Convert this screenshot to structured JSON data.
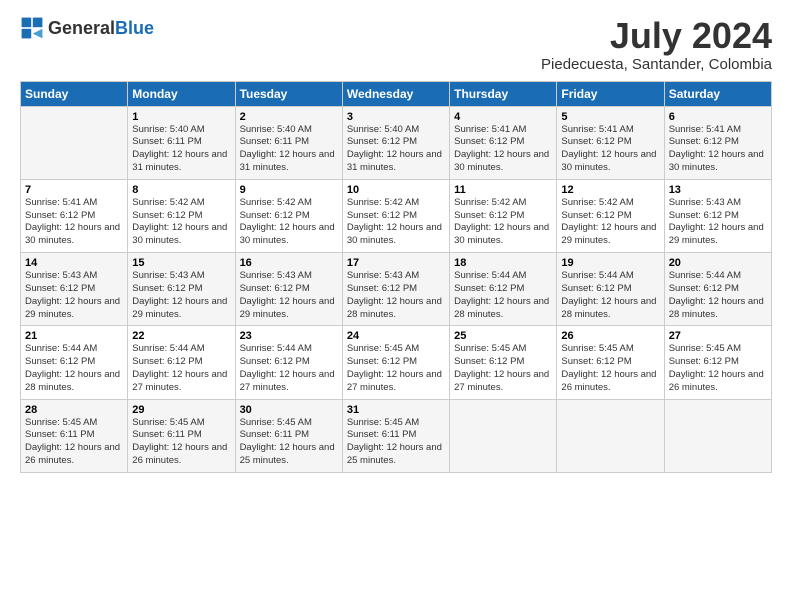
{
  "logo": {
    "general": "General",
    "blue": "Blue"
  },
  "title": "July 2024",
  "subtitle": "Piedecuesta, Santander, Colombia",
  "days_of_week": [
    "Sunday",
    "Monday",
    "Tuesday",
    "Wednesday",
    "Thursday",
    "Friday",
    "Saturday"
  ],
  "weeks": [
    [
      {
        "day": "",
        "sunrise": "",
        "sunset": "",
        "daylight": ""
      },
      {
        "day": "1",
        "sunrise": "Sunrise: 5:40 AM",
        "sunset": "Sunset: 6:11 PM",
        "daylight": "Daylight: 12 hours and 31 minutes."
      },
      {
        "day": "2",
        "sunrise": "Sunrise: 5:40 AM",
        "sunset": "Sunset: 6:11 PM",
        "daylight": "Daylight: 12 hours and 31 minutes."
      },
      {
        "day": "3",
        "sunrise": "Sunrise: 5:40 AM",
        "sunset": "Sunset: 6:12 PM",
        "daylight": "Daylight: 12 hours and 31 minutes."
      },
      {
        "day": "4",
        "sunrise": "Sunrise: 5:41 AM",
        "sunset": "Sunset: 6:12 PM",
        "daylight": "Daylight: 12 hours and 30 minutes."
      },
      {
        "day": "5",
        "sunrise": "Sunrise: 5:41 AM",
        "sunset": "Sunset: 6:12 PM",
        "daylight": "Daylight: 12 hours and 30 minutes."
      },
      {
        "day": "6",
        "sunrise": "Sunrise: 5:41 AM",
        "sunset": "Sunset: 6:12 PM",
        "daylight": "Daylight: 12 hours and 30 minutes."
      }
    ],
    [
      {
        "day": "7",
        "sunrise": "Sunrise: 5:41 AM",
        "sunset": "Sunset: 6:12 PM",
        "daylight": "Daylight: 12 hours and 30 minutes."
      },
      {
        "day": "8",
        "sunrise": "Sunrise: 5:42 AM",
        "sunset": "Sunset: 6:12 PM",
        "daylight": "Daylight: 12 hours and 30 minutes."
      },
      {
        "day": "9",
        "sunrise": "Sunrise: 5:42 AM",
        "sunset": "Sunset: 6:12 PM",
        "daylight": "Daylight: 12 hours and 30 minutes."
      },
      {
        "day": "10",
        "sunrise": "Sunrise: 5:42 AM",
        "sunset": "Sunset: 6:12 PM",
        "daylight": "Daylight: 12 hours and 30 minutes."
      },
      {
        "day": "11",
        "sunrise": "Sunrise: 5:42 AM",
        "sunset": "Sunset: 6:12 PM",
        "daylight": "Daylight: 12 hours and 30 minutes."
      },
      {
        "day": "12",
        "sunrise": "Sunrise: 5:42 AM",
        "sunset": "Sunset: 6:12 PM",
        "daylight": "Daylight: 12 hours and 29 minutes."
      },
      {
        "day": "13",
        "sunrise": "Sunrise: 5:43 AM",
        "sunset": "Sunset: 6:12 PM",
        "daylight": "Daylight: 12 hours and 29 minutes."
      }
    ],
    [
      {
        "day": "14",
        "sunrise": "Sunrise: 5:43 AM",
        "sunset": "Sunset: 6:12 PM",
        "daylight": "Daylight: 12 hours and 29 minutes."
      },
      {
        "day": "15",
        "sunrise": "Sunrise: 5:43 AM",
        "sunset": "Sunset: 6:12 PM",
        "daylight": "Daylight: 12 hours and 29 minutes."
      },
      {
        "day": "16",
        "sunrise": "Sunrise: 5:43 AM",
        "sunset": "Sunset: 6:12 PM",
        "daylight": "Daylight: 12 hours and 29 minutes."
      },
      {
        "day": "17",
        "sunrise": "Sunrise: 5:43 AM",
        "sunset": "Sunset: 6:12 PM",
        "daylight": "Daylight: 12 hours and 28 minutes."
      },
      {
        "day": "18",
        "sunrise": "Sunrise: 5:44 AM",
        "sunset": "Sunset: 6:12 PM",
        "daylight": "Daylight: 12 hours and 28 minutes."
      },
      {
        "day": "19",
        "sunrise": "Sunrise: 5:44 AM",
        "sunset": "Sunset: 6:12 PM",
        "daylight": "Daylight: 12 hours and 28 minutes."
      },
      {
        "day": "20",
        "sunrise": "Sunrise: 5:44 AM",
        "sunset": "Sunset: 6:12 PM",
        "daylight": "Daylight: 12 hours and 28 minutes."
      }
    ],
    [
      {
        "day": "21",
        "sunrise": "Sunrise: 5:44 AM",
        "sunset": "Sunset: 6:12 PM",
        "daylight": "Daylight: 12 hours and 28 minutes."
      },
      {
        "day": "22",
        "sunrise": "Sunrise: 5:44 AM",
        "sunset": "Sunset: 6:12 PM",
        "daylight": "Daylight: 12 hours and 27 minutes."
      },
      {
        "day": "23",
        "sunrise": "Sunrise: 5:44 AM",
        "sunset": "Sunset: 6:12 PM",
        "daylight": "Daylight: 12 hours and 27 minutes."
      },
      {
        "day": "24",
        "sunrise": "Sunrise: 5:45 AM",
        "sunset": "Sunset: 6:12 PM",
        "daylight": "Daylight: 12 hours and 27 minutes."
      },
      {
        "day": "25",
        "sunrise": "Sunrise: 5:45 AM",
        "sunset": "Sunset: 6:12 PM",
        "daylight": "Daylight: 12 hours and 27 minutes."
      },
      {
        "day": "26",
        "sunrise": "Sunrise: 5:45 AM",
        "sunset": "Sunset: 6:12 PM",
        "daylight": "Daylight: 12 hours and 26 minutes."
      },
      {
        "day": "27",
        "sunrise": "Sunrise: 5:45 AM",
        "sunset": "Sunset: 6:12 PM",
        "daylight": "Daylight: 12 hours and 26 minutes."
      }
    ],
    [
      {
        "day": "28",
        "sunrise": "Sunrise: 5:45 AM",
        "sunset": "Sunset: 6:11 PM",
        "daylight": "Daylight: 12 hours and 26 minutes."
      },
      {
        "day": "29",
        "sunrise": "Sunrise: 5:45 AM",
        "sunset": "Sunset: 6:11 PM",
        "daylight": "Daylight: 12 hours and 26 minutes."
      },
      {
        "day": "30",
        "sunrise": "Sunrise: 5:45 AM",
        "sunset": "Sunset: 6:11 PM",
        "daylight": "Daylight: 12 hours and 25 minutes."
      },
      {
        "day": "31",
        "sunrise": "Sunrise: 5:45 AM",
        "sunset": "Sunset: 6:11 PM",
        "daylight": "Daylight: 12 hours and 25 minutes."
      },
      {
        "day": "",
        "sunrise": "",
        "sunset": "",
        "daylight": ""
      },
      {
        "day": "",
        "sunrise": "",
        "sunset": "",
        "daylight": ""
      },
      {
        "day": "",
        "sunrise": "",
        "sunset": "",
        "daylight": ""
      }
    ]
  ]
}
